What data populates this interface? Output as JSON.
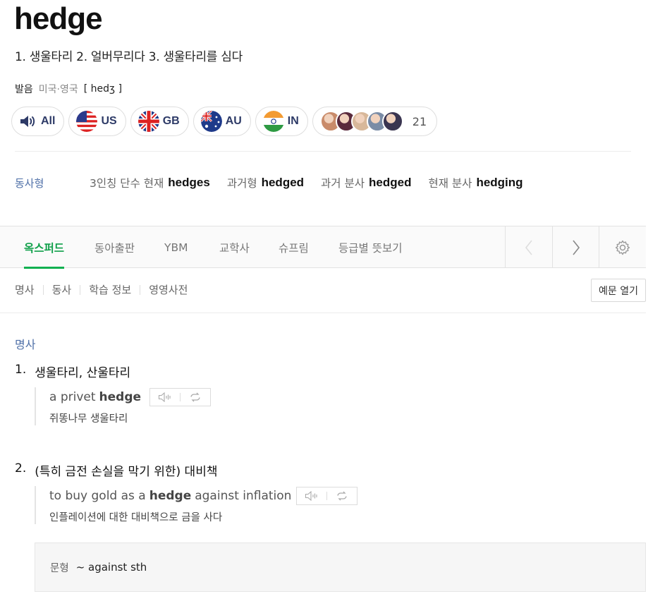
{
  "entry": {
    "headword": "hedge",
    "meanings": "1. 생울타리 2. 얼버무리다 3. 생울타리를 심다"
  },
  "pronunciation": {
    "label": "발음",
    "region": "미국·영국",
    "ipa": "[ hedʒ ]"
  },
  "audio_buttons": [
    {
      "label": "All",
      "icon": "speaker-icon"
    },
    {
      "label": "US",
      "icon": "us-flag-icon"
    },
    {
      "label": "GB",
      "icon": "uk-flag-icon"
    },
    {
      "label": "AU",
      "icon": "australia-flag-icon"
    },
    {
      "label": "IN",
      "icon": "india-flag-icon"
    }
  ],
  "user_pronunciations": {
    "count": "21",
    "avatar_colors": [
      "#c98b6a",
      "#5a2a3c",
      "#d8b89a",
      "#7a8ca6",
      "#3a3550"
    ]
  },
  "verb_forms": {
    "label": "동사형",
    "items": [
      {
        "label": "3인칭 단수 현재",
        "word": "hedges"
      },
      {
        "label": "과거형",
        "word": "hedged"
      },
      {
        "label": "과거 분사",
        "word": "hedged"
      },
      {
        "label": "현재 분사",
        "word": "hedging"
      }
    ]
  },
  "tabs": {
    "items": [
      "옥스퍼드",
      "동아출판",
      "YBM",
      "교학사",
      "슈프림",
      "등급별 뜻보기"
    ],
    "active": "옥스퍼드"
  },
  "subnav": {
    "items": [
      "명사",
      "동사",
      "학습 정보",
      "영영사전"
    ],
    "example_toggle": "예문 열기"
  },
  "pos_section": {
    "label": "명사",
    "senses": [
      {
        "num": "1.",
        "definition": "생울타리, 산울타리",
        "example_pre": "a privet",
        "example_bold": "hedge",
        "example_post": "",
        "translation": "쥐똥나무 생울타리"
      },
      {
        "num": "2.",
        "definition": "(특히 금전 손실을 막기 위한) 대비책",
        "example_pre": "to buy gold as a",
        "example_bold": "hedge",
        "example_post": "against inflation",
        "translation": "인플레이션에 대한 대비책으로 금을 사다"
      }
    ],
    "pattern": {
      "label": "문형",
      "text": "~ against sth"
    }
  },
  "colors": {
    "accent_green": "#10a04a",
    "pos_blue": "#4f70a8",
    "button_text_navy": "#2d3a67"
  }
}
